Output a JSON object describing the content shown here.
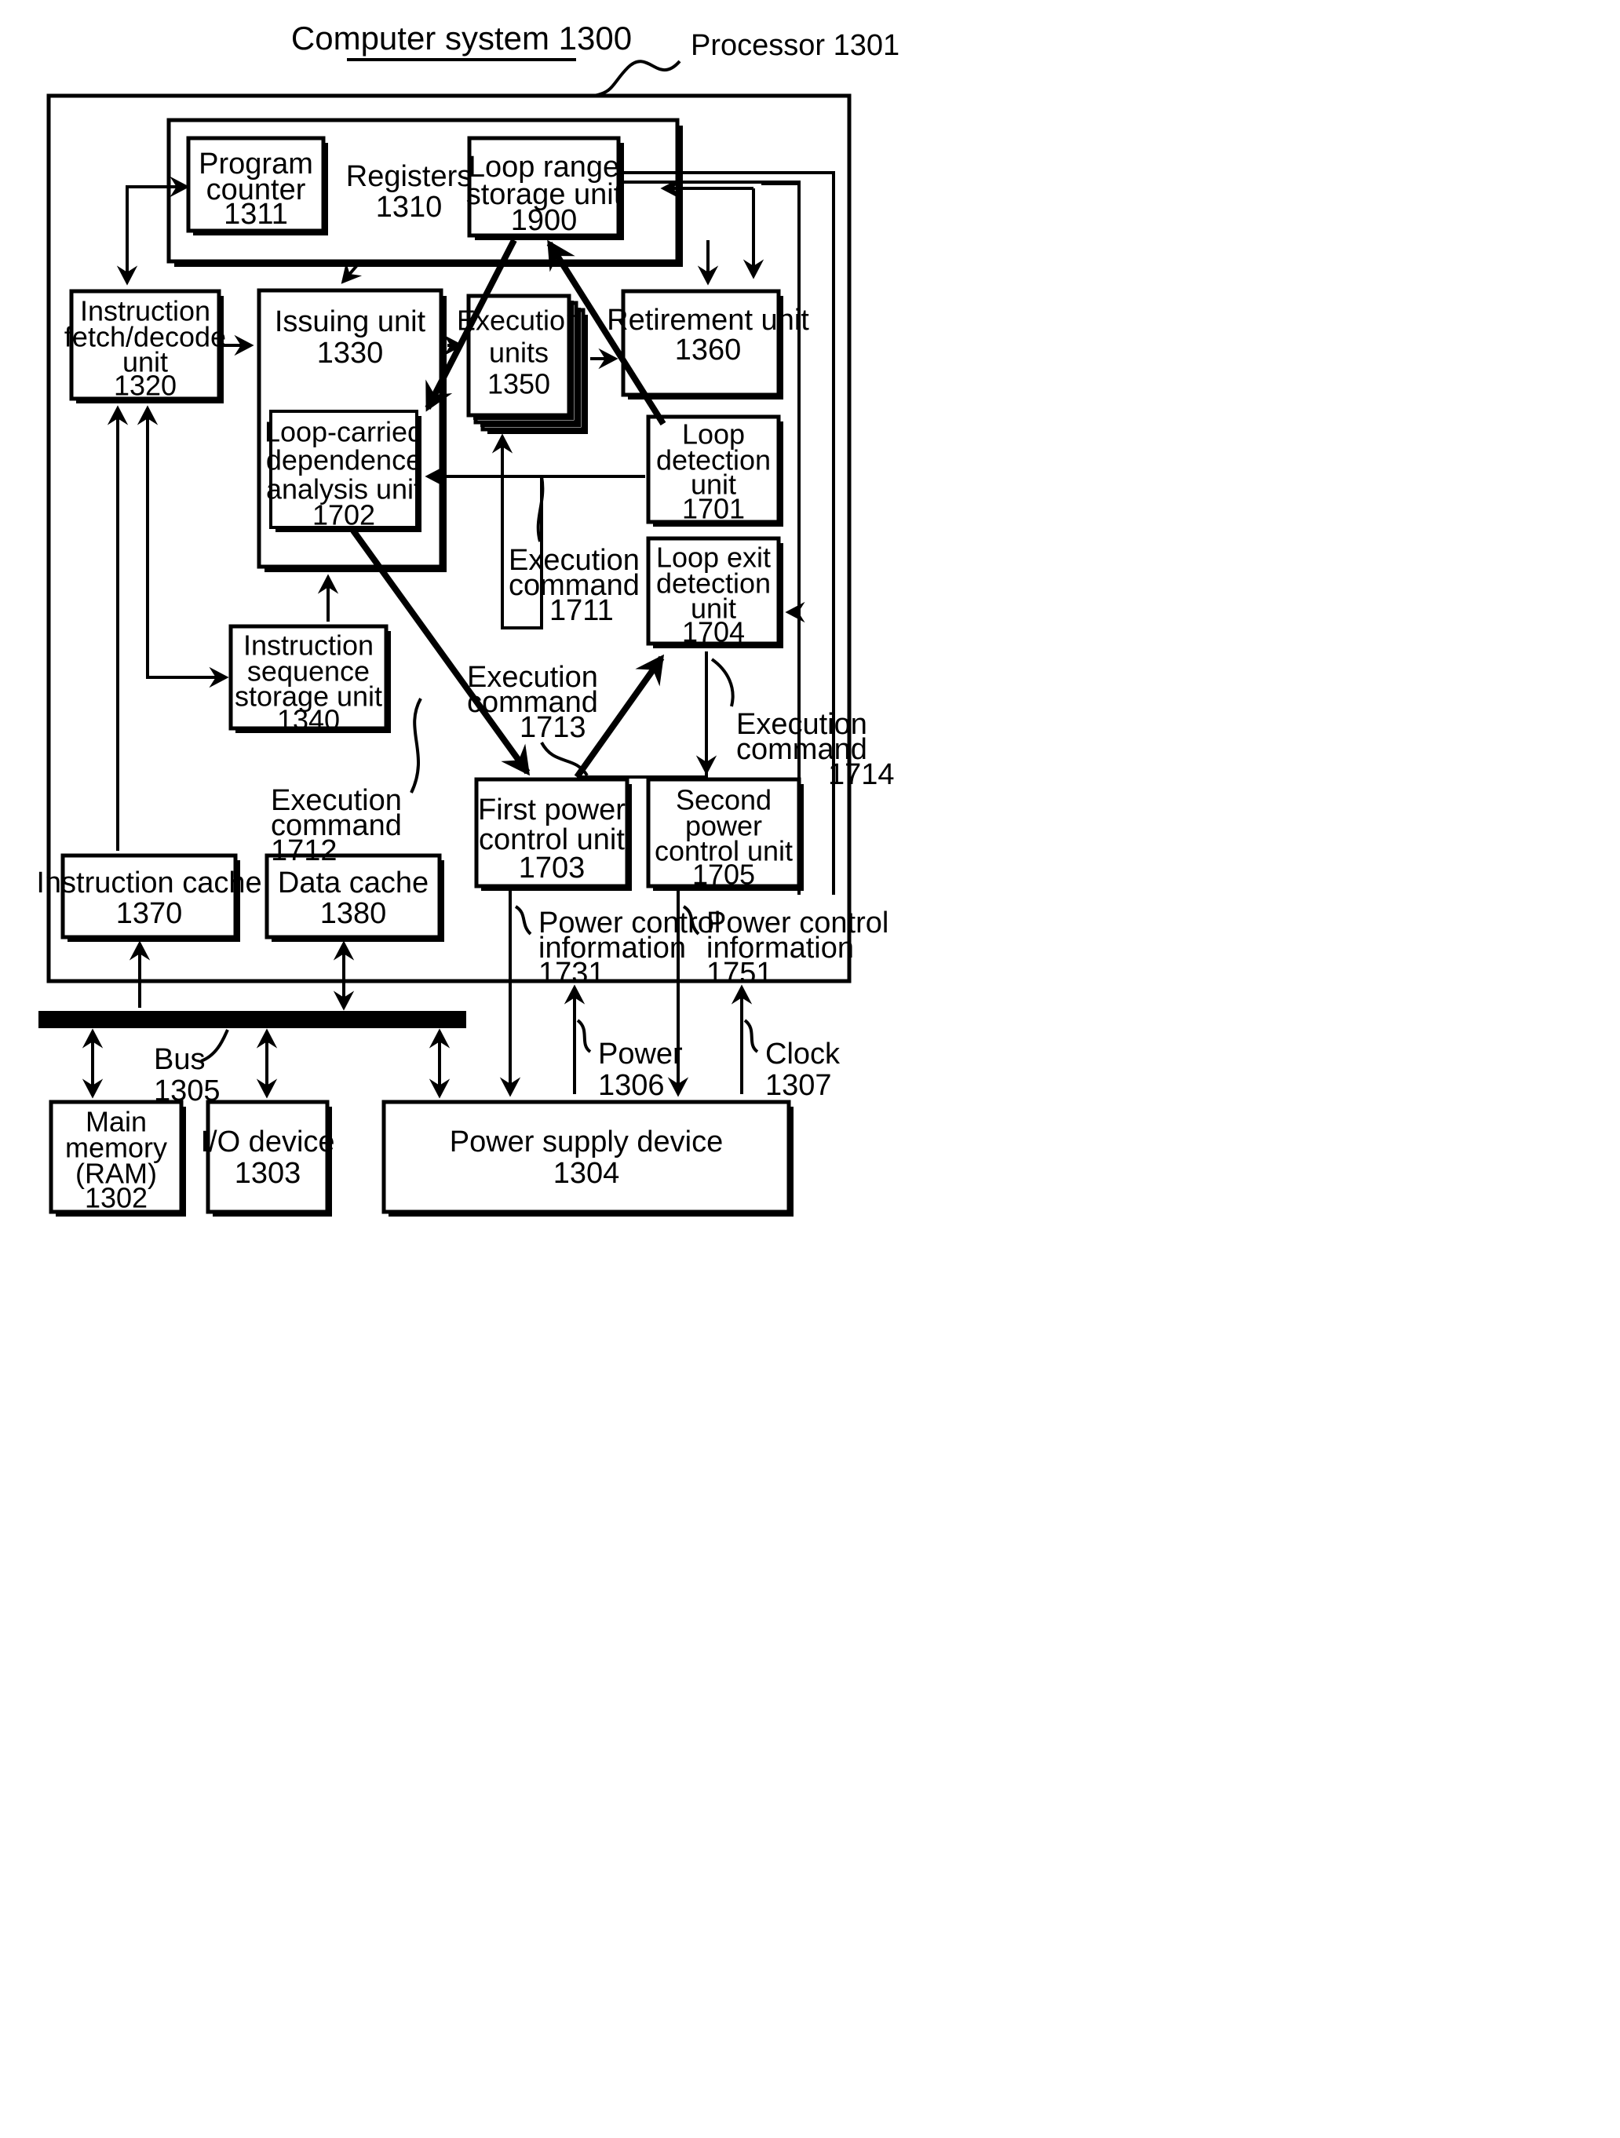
{
  "figure": {
    "title": "Computer system 1300",
    "processor_label": "Processor 1301"
  },
  "registers_group": {
    "label_line1": "Registers",
    "label_line2": "1310"
  },
  "boxes": {
    "program_counter": {
      "l1": "Program",
      "l2": "counter",
      "l3": "1311",
      "l4": ""
    },
    "loop_range_storage": {
      "l1": "Loop range",
      "l2": "storage unit",
      "l3": "1900",
      "l4": ""
    },
    "instruction_fetch": {
      "l1": "Instruction",
      "l2": "fetch/decode",
      "l3": "unit",
      "l4": "1320"
    },
    "issuing_unit": {
      "l1": "Issuing unit",
      "l2": "1330",
      "l3": "",
      "l4": ""
    },
    "execution_units": {
      "l1": "Execution",
      "l2": "units",
      "l3": "1350",
      "l4": ""
    },
    "retirement_unit": {
      "l1": "Retirement unit",
      "l2": "1360",
      "l3": "",
      "l4": ""
    },
    "loop_carried": {
      "l1": "Loop-carried",
      "l2": "dependence",
      "l3": "analysis unit",
      "l4": "1702"
    },
    "loop_detection": {
      "l1": "Loop",
      "l2": "detection",
      "l3": "unit",
      "l4": "1701"
    },
    "loop_exit_detection": {
      "l1": "Loop exit",
      "l2": "detection",
      "l3": "unit",
      "l4": "1704"
    },
    "instruction_seq": {
      "l1": "Instruction",
      "l2": "sequence",
      "l3": "storage unit",
      "l4": "1340"
    },
    "first_power": {
      "l1": "First power",
      "l2": "control unit",
      "l3": "1703",
      "l4": ""
    },
    "second_power": {
      "l1": "Second",
      "l2": "power",
      "l3": "control unit",
      "l4": "1705"
    },
    "instruction_cache": {
      "l1": "Instruction cache",
      "l2": "1370",
      "l3": "",
      "l4": ""
    },
    "data_cache": {
      "l1": "Data cache",
      "l2": "1380",
      "l3": "",
      "l4": ""
    },
    "main_memory": {
      "l1": "Main",
      "l2": "memory",
      "l3": "(RAM)",
      "l4": "1302"
    },
    "io_device": {
      "l1": "I/O device",
      "l2": "1303",
      "l3": "",
      "l4": ""
    },
    "power_supply": {
      "l1": "Power supply device",
      "l2": "1304",
      "l3": "",
      "l4": ""
    }
  },
  "annotations": {
    "exec_cmd_1711": {
      "l1": "Execution",
      "l2": "command",
      "l3": "1711"
    },
    "exec_cmd_1712": {
      "l1": "Execution",
      "l2": "command",
      "l3": "1712"
    },
    "exec_cmd_1713": {
      "l1": "Execution",
      "l2": "command",
      "l3": "1713"
    },
    "exec_cmd_1714": {
      "l1": "Execution",
      "l2": "command",
      "l3": "1714"
    },
    "pwr_info_1731": {
      "l1": "Power control",
      "l2": "information",
      "l3": "1731"
    },
    "pwr_info_1751": {
      "l1": "Power control",
      "l2": "information",
      "l3": "1751"
    },
    "bus": {
      "l1": "Bus",
      "l2": "1305"
    },
    "power": {
      "l1": "Power",
      "l2": "1306"
    },
    "clock": {
      "l1": "Clock",
      "l2": "1307"
    }
  },
  "colors": {
    "ink": "#000000",
    "paper": "#ffffff"
  }
}
